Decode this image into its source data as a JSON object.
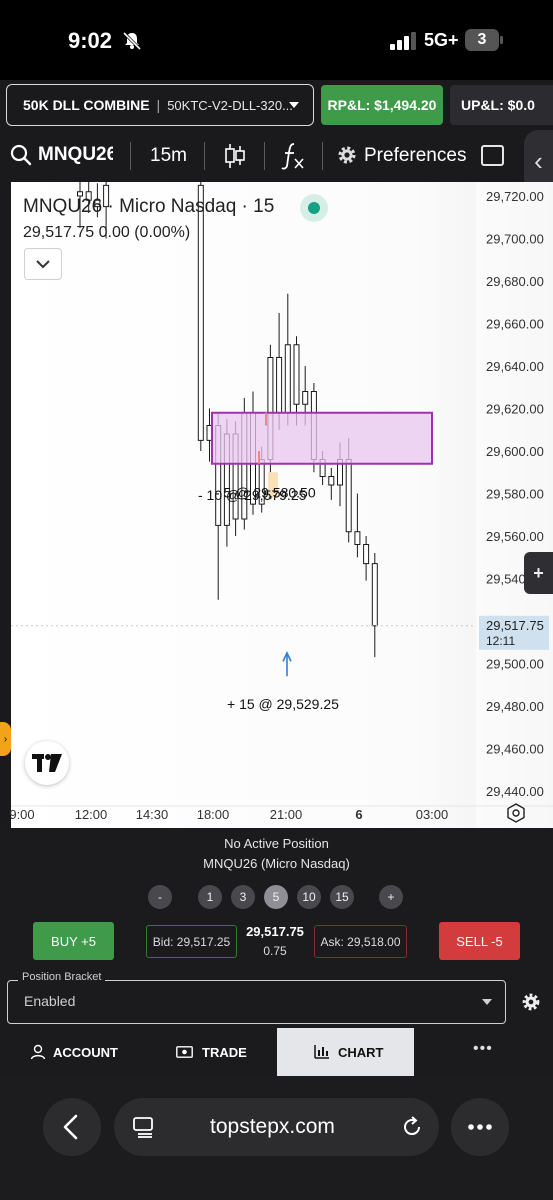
{
  "status_bar": {
    "time": "9:02",
    "network": "5G+",
    "battery_badge": "3"
  },
  "account_bar": {
    "account_name": "50K DLL COMBINE",
    "account_id": "50KTC-V2-DLL-320...",
    "rpl_label": "RP&L: $1,494.20",
    "upl_label": "UP&L: $0.0"
  },
  "toolbar": {
    "symbol": "MNQU26",
    "interval": "15m",
    "fx_icon": "fx-icon",
    "preferences_label": "Preferences"
  },
  "chart": {
    "legend_title": "MNQU26 · Micro Nasdaq · 15",
    "legend_price": "29,517.75  0.00 (0.00%)",
    "colors": {
      "up": "#ffffff",
      "down": "#1a1a1a",
      "zone_fill": "#e8c7ef",
      "zone_border": "#a030b0",
      "current_label_bg": "#cfe0ef"
    }
  },
  "chart_data": {
    "type": "candlestick",
    "y_ticks": [
      "29,720.00",
      "29,700.00",
      "29,680.00",
      "29,660.00",
      "29,640.00",
      "29,620.00",
      "29,600.00",
      "29,580.00",
      "29,560.00",
      "29,540.00",
      "29,520.00",
      "29,500.00",
      "29,480.00",
      "29,460.00",
      "29,440.00"
    ],
    "x_ticks": [
      "9:00",
      "12:00",
      "14:30",
      "18:00",
      "21:00",
      "6",
      "03:00"
    ],
    "ylim": [
      29440,
      29720
    ],
    "current_price_label": "29,517.75",
    "current_price_timer": "12:11",
    "current_price": 29517.75,
    "annotations": [
      {
        "text": "- 5 @ 29,580.50",
        "price": 29580.5
      },
      {
        "text": "- 10 @ 29,579.25",
        "price": 29579.25
      },
      {
        "text": "+ 15 @ 29,529.25",
        "price": 29529.25
      }
    ],
    "zone": {
      "top": 29618,
      "bottom": 29594
    },
    "candles": [
      {
        "o": 29720,
        "h": 29730,
        "l": 29705,
        "c": 29722
      },
      {
        "o": 29722,
        "h": 29728,
        "l": 29712,
        "c": 29718
      },
      {
        "o": 29718,
        "h": 29726,
        "l": 29710,
        "c": 29715
      },
      {
        "o": 29715,
        "h": 29735,
        "l": 29700,
        "c": 29725
      },
      {
        "o": 29725,
        "h": 29730,
        "l": 29600,
        "c": 29605
      },
      {
        "o": 29605,
        "h": 29620,
        "l": 29595,
        "c": 29612
      },
      {
        "o": 29612,
        "h": 29618,
        "l": 29530,
        "c": 29565
      },
      {
        "o": 29565,
        "h": 29615,
        "l": 29555,
        "c": 29608
      },
      {
        "o": 29608,
        "h": 29614,
        "l": 29560,
        "c": 29568
      },
      {
        "o": 29568,
        "h": 29625,
        "l": 29563,
        "c": 29618
      },
      {
        "o": 29618,
        "h": 29628,
        "l": 29570,
        "c": 29575
      },
      {
        "o": 29575,
        "h": 29602,
        "l": 29571,
        "c": 29596
      },
      {
        "o": 29596,
        "h": 29650,
        "l": 29590,
        "c": 29644
      },
      {
        "o": 29644,
        "h": 29665,
        "l": 29610,
        "c": 29618
      },
      {
        "o": 29618,
        "h": 29674,
        "l": 29612,
        "c": 29650
      },
      {
        "o": 29650,
        "h": 29654,
        "l": 29612,
        "c": 29622
      },
      {
        "o": 29622,
        "h": 29640,
        "l": 29612,
        "c": 29628
      },
      {
        "o": 29628,
        "h": 29632,
        "l": 29590,
        "c": 29596
      },
      {
        "o": 29596,
        "h": 29600,
        "l": 29584,
        "c": 29588
      },
      {
        "o": 29588,
        "h": 29592,
        "l": 29577,
        "c": 29584
      },
      {
        "o": 29584,
        "h": 29604,
        "l": 29574,
        "c": 29596
      },
      {
        "o": 29596,
        "h": 29606,
        "l": 29557,
        "c": 29562
      },
      {
        "o": 29562,
        "h": 29580,
        "l": 29550,
        "c": 29556
      },
      {
        "o": 29556,
        "h": 29560,
        "l": 29539,
        "c": 29547
      },
      {
        "o": 29547,
        "h": 29552,
        "l": 29503,
        "c": 29517.75
      }
    ]
  },
  "trade_panel": {
    "position_status": "No Active Position",
    "instrument": "MNQU26 (Micro Nasdaq)",
    "qty_buttons": [
      "-",
      "1",
      "3",
      "5",
      "10",
      "15",
      "+"
    ],
    "selected_qty": "5",
    "buy_label": "BUY +5",
    "sell_label": "SELL -5",
    "bid_label": "Bid: 29,517.25",
    "ask_label": "Ask: 29,518.00",
    "last_price": "29,517.75",
    "last_size": "0.75",
    "bracket_label": "Position Bracket",
    "bracket_value": "Enabled"
  },
  "bottom_nav": {
    "account": "ACCOUNT",
    "trade": "TRADE",
    "chart": "CHART",
    "more": "•••"
  },
  "browser": {
    "url": "topstepx.com"
  }
}
